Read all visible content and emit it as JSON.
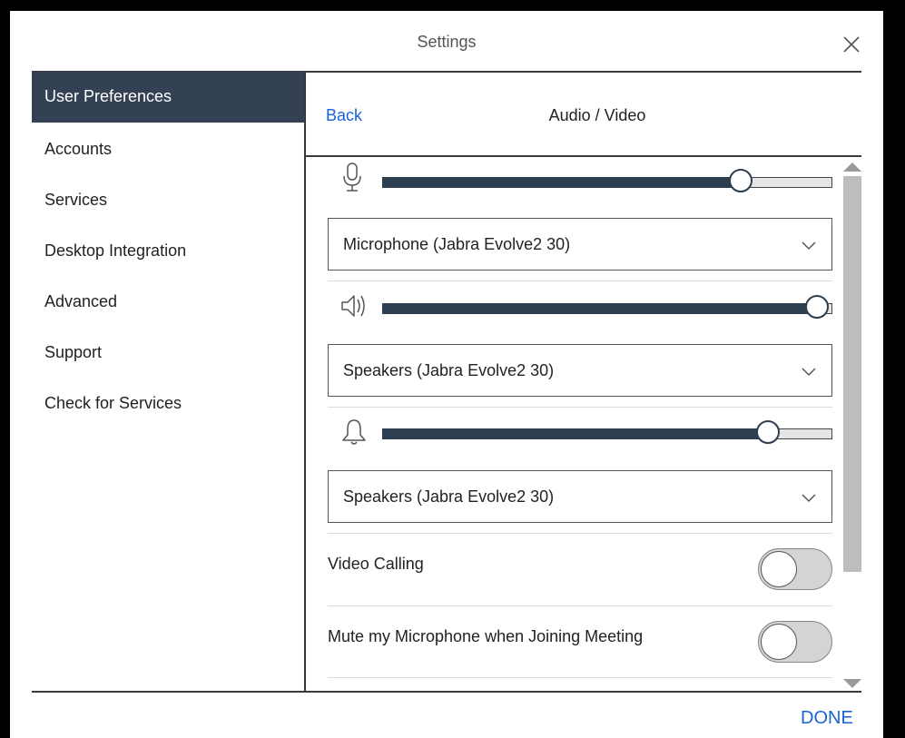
{
  "dialog": {
    "title": "Settings",
    "close_icon": "close-icon",
    "done_label": "DONE"
  },
  "sidebar": {
    "items": [
      {
        "label": "User Preferences",
        "active": true
      },
      {
        "label": "Accounts",
        "active": false
      },
      {
        "label": "Services",
        "active": false
      },
      {
        "label": "Desktop Integration",
        "active": false
      },
      {
        "label": "Advanced",
        "active": false
      },
      {
        "label": "Support",
        "active": false
      },
      {
        "label": "Check for Services",
        "active": false
      }
    ]
  },
  "panel": {
    "back_label": "Back",
    "title": "Audio / Video",
    "microphone": {
      "icon": "microphone-icon",
      "volume": 0.8,
      "device": "Microphone (Jabra Evolve2 30)"
    },
    "speakers": {
      "icon": "speaker-icon",
      "volume": 0.97,
      "device": "Speakers (Jabra Evolve2 30)"
    },
    "ringer": {
      "icon": "bell-icon",
      "volume": 0.86,
      "device": "Speakers (Jabra Evolve2 30)"
    },
    "toggles": [
      {
        "label": "Video Calling",
        "on": false
      },
      {
        "label": "Mute my Microphone when Joining Meeting",
        "on": false
      }
    ]
  },
  "colors": {
    "accent": "#1a63d6",
    "sidebar_active_bg": "#344155",
    "slider_fill": "#2c3e50"
  }
}
